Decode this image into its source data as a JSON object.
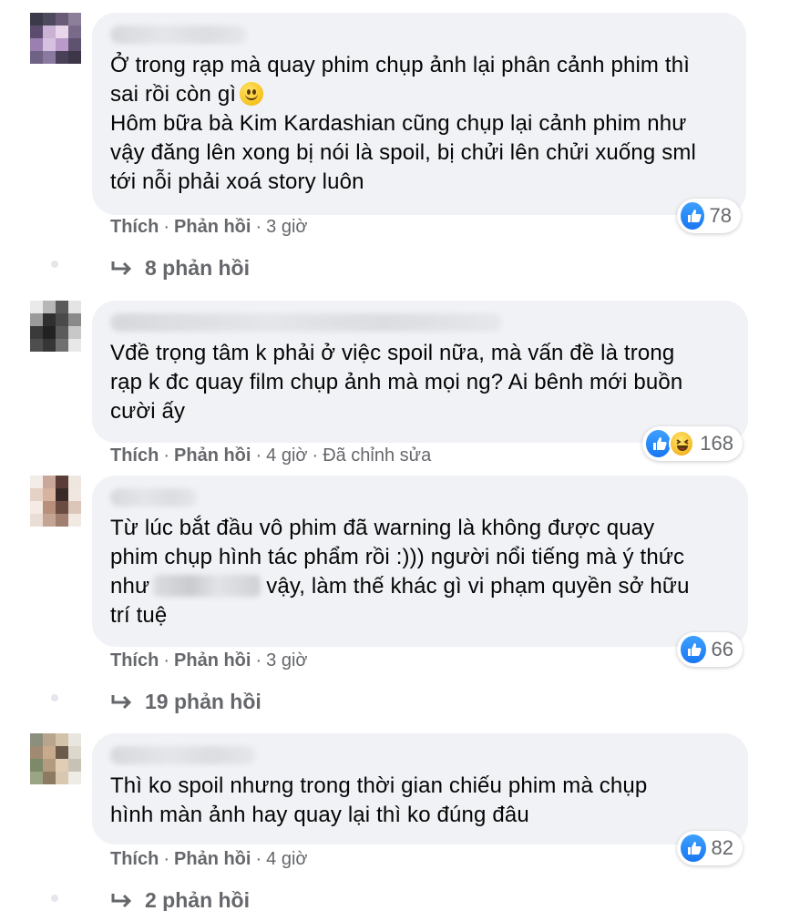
{
  "comments": [
    {
      "lines": [
        "Ở trong rạp mà quay phim chụp ảnh lại phân cảnh phim thì",
        "sai rồi còn gì",
        "Hôm bữa bà Kim Kardashian cũng chụp lại cảnh phim như",
        "vậy đăng lên xong bị nói là spoil, bị chửi lên chửi xuống sml",
        "tới nỗi phải xoá story luôn"
      ],
      "emoji": "slightly-smiling-face",
      "like_label": "Thích",
      "reply_label": "Phản hồi",
      "time": "3 giờ",
      "reaction_icons": [
        "like-icon"
      ],
      "reaction_count": "78",
      "replies": "8 phản hồi"
    },
    {
      "lines": [
        "Vđề trọng tâm k phải ở việc spoil nữa, mà vấn đề là trong",
        "rạp k đc quay film chụp ảnh mà mọi ng? Ai bênh mới buồn",
        "cười ấy"
      ],
      "like_label": "Thích",
      "reply_label": "Phản hồi",
      "time": "4 giờ",
      "edited": "Đã chỉnh sửa",
      "reaction_icons": [
        "like-icon",
        "haha-icon"
      ],
      "reaction_count": "168"
    },
    {
      "lines": [
        "Từ lúc bắt đầu vô phim đã warning là không được quay",
        "phim chụp hình tác phẩm rồi :))) người nổi tiếng mà ý thức",
        "như",
        "vậy, làm thế khác gì vi phạm quyền sở hữu",
        "trí tuệ"
      ],
      "like_label": "Thích",
      "reply_label": "Phản hồi",
      "time": "3 giờ",
      "reaction_icons": [
        "like-icon"
      ],
      "reaction_count": "66",
      "replies": "19 phản hồi"
    },
    {
      "lines": [
        "Thì ko spoil nhưng trong thời gian chiếu phim mà chụp",
        "hình màn ảnh hay quay lại thì ko đúng đâu"
      ],
      "like_label": "Thích",
      "reply_label": "Phản hồi",
      "time": "4 giờ",
      "reaction_icons": [
        "like-icon"
      ],
      "reaction_count": "82",
      "replies": "2 phản hồi"
    }
  ],
  "colors": {
    "bubble": "#f0f2f5",
    "text": "#050505",
    "meta": "#65676b",
    "like_blue": "#1877f2",
    "haha_yellow": "#f7b928"
  }
}
